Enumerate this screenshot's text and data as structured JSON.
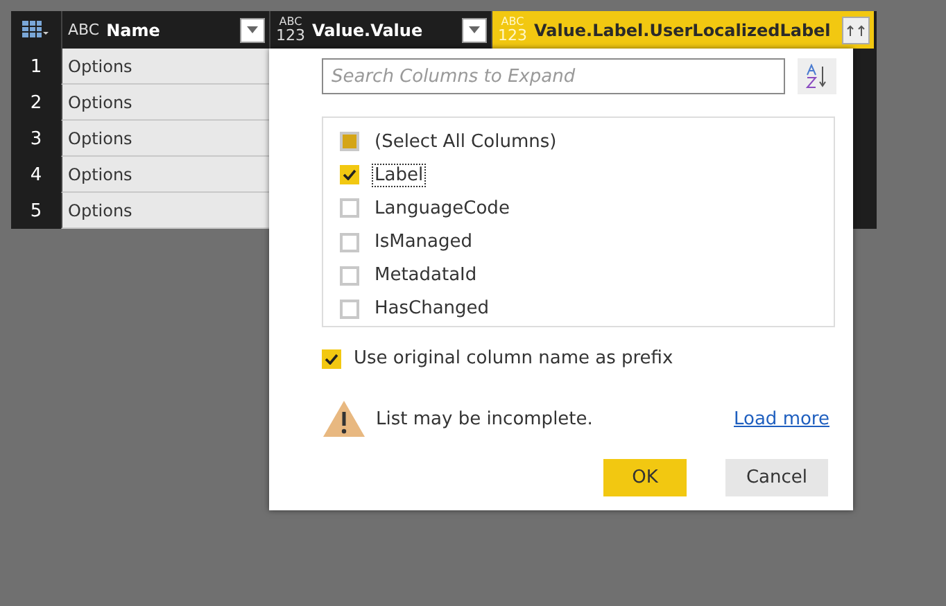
{
  "table": {
    "columns": [
      {
        "label": "Name",
        "type_icon": "ABC",
        "filter": true,
        "selected": false
      },
      {
        "label": "Value.Value",
        "type_icon": "ABC123",
        "filter": true,
        "selected": false
      },
      {
        "label": "Value.Label.UserLocalizedLabel",
        "type_icon": "ABC123",
        "filter": false,
        "selected": true
      }
    ],
    "rows": [
      {
        "number": "1",
        "name": "Options"
      },
      {
        "number": "2",
        "name": "Options"
      },
      {
        "number": "3",
        "name": "Options"
      },
      {
        "number": "4",
        "name": "Options"
      },
      {
        "number": "5",
        "name": "Options"
      }
    ]
  },
  "expand_popup": {
    "search": {
      "placeholder": "Search Columns to Expand"
    },
    "select_all": {
      "label": "(Select All Columns)",
      "indeterminate": true
    },
    "columns": [
      {
        "label": "Label",
        "checked": true,
        "focused": true
      },
      {
        "label": "LanguageCode",
        "checked": false,
        "focused": false
      },
      {
        "label": "IsManaged",
        "checked": false,
        "focused": false
      },
      {
        "label": "MetadataId",
        "checked": false,
        "focused": false
      },
      {
        "label": "HasChanged",
        "checked": false,
        "focused": false
      }
    ],
    "prefix": {
      "label": "Use original column name as prefix",
      "checked": true
    },
    "warning": "List may be incomplete.",
    "load_more": "Load more",
    "buttons": [
      {
        "label": "OK",
        "primary": true
      },
      {
        "label": "Cancel",
        "primary": false
      }
    ]
  }
}
